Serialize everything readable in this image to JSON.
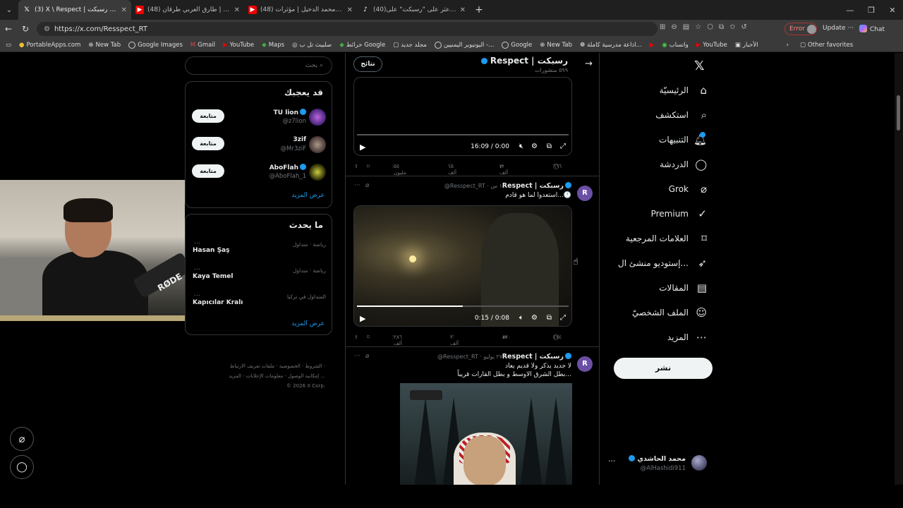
{
  "browser": {
    "tabs": [
      {
        "title": "(3) X \\ Respect | رسبكت (@Resspect_RT)",
        "favicon": "X",
        "active": true
      },
      {
        "title": "(48) صقور الارض | طارق العربي طرقان",
        "favicon": "yt",
        "active": false
      },
      {
        "title": "(48) شيلة مشينا | محمد الدخيل | مؤثرات",
        "favicon": "yt",
        "active": false
      },
      {
        "title": "(40)اعثر على \"رسبكت\" على TikTok",
        "favicon": "tiktok",
        "active": false
      }
    ],
    "url": "https://x.com/Resspect_RT",
    "error_label": "Error",
    "update_label": "Update",
    "chat_label": "Chat",
    "bookmarks": [
      "PortableApps.com",
      "New Tab",
      "Google Images",
      "Gmail",
      "YouTube",
      "Maps",
      "صلبيث تل ب",
      "خرائط Google",
      "مجلد جديد",
      "اليوتيوبر اليمنيين -...",
      "Google",
      "New Tab",
      "اذاعة مدرسية كاملة...",
      "واتساب",
      "YouTube",
      "الأخبار"
    ],
    "other_favorites": "Other favorites"
  },
  "right_sidebar": {
    "search_placeholder": "بحث",
    "who_to_follow": {
      "title": "قد يعجبك",
      "users": [
        {
          "name": "TU lion",
          "handle": "@z7lion",
          "button": "متابعة"
        },
        {
          "name": "3zif",
          "handle": "@Mr3ziF",
          "button": "متابعة"
        },
        {
          "name": "AboFlah",
          "handle": "@AboFlah_1",
          "button": "متابعة"
        }
      ],
      "show_more": "عرض المزيد"
    },
    "trends": {
      "title": "ما يحدث",
      "items": [
        {
          "meta": "رياضة · متداول",
          "name": "Hasan Şaş"
        },
        {
          "meta": "رياضة · متداول",
          "name": "Kaya Temel"
        },
        {
          "meta": "المتداول في تركيا",
          "name": "Kapıcılar Kralı"
        }
      ],
      "show_more": "عرض المزيد"
    },
    "footer": [
      "الشروط",
      "الخصوصية",
      "ملفات تعريف الارتباط",
      "إمكانية الوصول",
      "معلومات الإعلانات",
      "المزيد ...",
      "© 2026 X Corp."
    ]
  },
  "timeline": {
    "header": {
      "title": "Respect | رسبكت",
      "subtitle": "٥٩٩ منشورات",
      "tab_button": "نتائج"
    },
    "video1": {
      "time": "16:09 / 0:00",
      "progress": 0
    },
    "post1_actions": {
      "replies": "٦٦٦",
      "reposts": "٢ آلف",
      "likes": "١٥ ألف",
      "views": "٥٥ مليون"
    },
    "post2": {
      "name": "Respect | رسبكت",
      "handle": "@Resspect_RT",
      "time": "١ س",
      "text": "استعدوا لما هو قادم...🕛",
      "video_time": "0:15 / 0:08",
      "progress": 0.5,
      "actions": {
        "replies": "٤٧٤",
        "reposts": "٨٧٠",
        "likes": "٢ آلف",
        "views": "٢٨٦ ألف"
      }
    },
    "post3": {
      "name": "Respect | رسبكت",
      "handle": "@Resspect_RT",
      "time": "٢٧ يوليو",
      "text1": "لا جديد يذكر ولا قديم يعاد",
      "text2": "بطل الشرق الاوسط و بطل القارات قريباً..."
    }
  },
  "left_nav": {
    "items": [
      {
        "label": "الرئيسيّة",
        "icon": "home-icon"
      },
      {
        "label": "استكشف",
        "icon": "search-icon"
      },
      {
        "label": "التنبيهات",
        "icon": "bell-icon"
      },
      {
        "label": "الدردشة",
        "icon": "chat-icon"
      },
      {
        "label": "Grok",
        "icon": "grok-icon"
      },
      {
        "label": "Premium",
        "icon": "premium-icon"
      },
      {
        "label": "العلامات المرجعية",
        "icon": "bookmark-icon"
      },
      {
        "label": "إستوديو منشئ ال...",
        "icon": "rocket-icon"
      },
      {
        "label": "المقالات",
        "icon": "article-icon"
      },
      {
        "label": "الملف الشخصيّ",
        "icon": "profile-icon"
      },
      {
        "label": "المزيد",
        "icon": "more-icon"
      }
    ],
    "post_button": "نشر",
    "account": {
      "name": "محمد الحاشدي",
      "handle": "@AlHashidi911"
    }
  }
}
